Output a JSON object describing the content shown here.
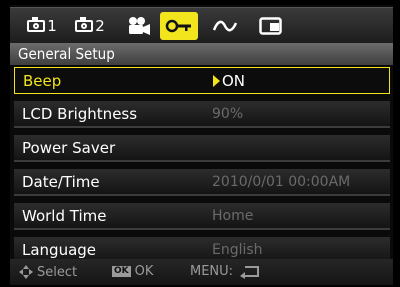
{
  "tabs": [
    {
      "icon": "camera-icon",
      "label": "1"
    },
    {
      "icon": "camera-icon",
      "label": "2"
    },
    {
      "icon": "movie-camera-icon",
      "label": ""
    },
    {
      "icon": "wrench-icon",
      "label": "",
      "active": true
    },
    {
      "icon": "curve-icon",
      "label": ""
    },
    {
      "icon": "playback-card-icon",
      "label": ""
    }
  ],
  "page_title": "General Setup",
  "settings": [
    {
      "label": "Beep",
      "value": "ON",
      "selected": true
    },
    {
      "label": "LCD Brightness",
      "value": "90%"
    },
    {
      "label": "Power Saver",
      "value": ""
    },
    {
      "label": "Date/Time",
      "value": "2010/0/01 00:00AM"
    },
    {
      "label": "World Time",
      "value": "Home"
    },
    {
      "label": "Language",
      "value": "English"
    }
  ],
  "footer": {
    "select_label": "Select",
    "ok_badge": "OK",
    "ok_label": "OK",
    "menu_label": "MENU:"
  },
  "colors": {
    "accent": "#f2e51d"
  }
}
